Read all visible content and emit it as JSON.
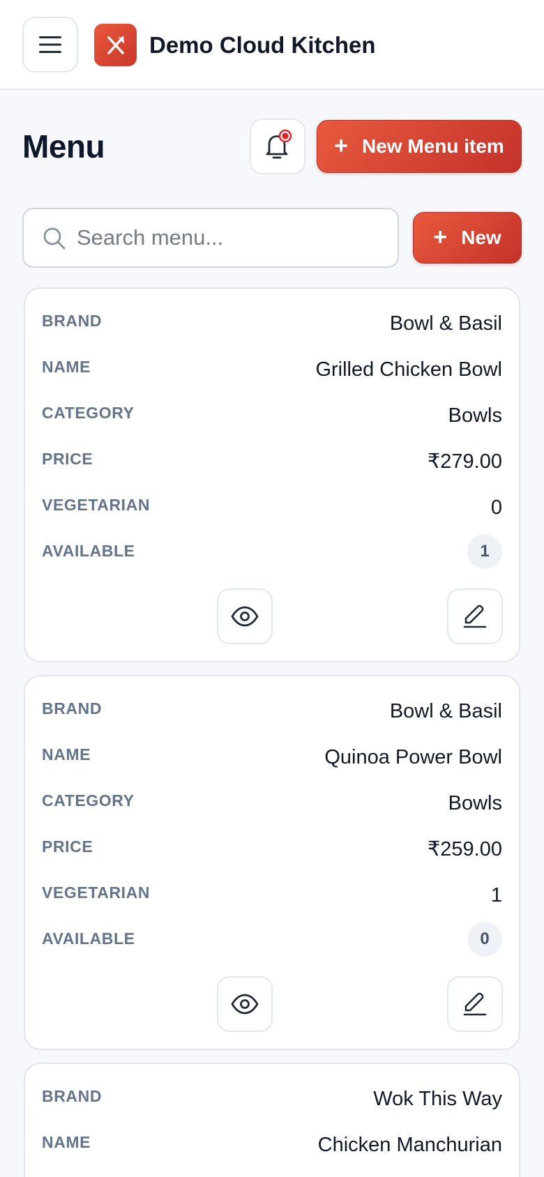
{
  "app": {
    "title": "Demo Cloud Kitchen",
    "brand_color": "#D9452F"
  },
  "header": {
    "page_title": "Menu",
    "new_menu_item_label": "New Menu item",
    "plus_glyph": "+"
  },
  "search": {
    "placeholder": "Search menu...",
    "value": "",
    "new_label": "New"
  },
  "fields": {
    "brand": "BRAND",
    "name": "NAME",
    "category": "CATEGORY",
    "price": "PRICE",
    "vegetarian": "VEGETARIAN",
    "available": "AVAILABLE"
  },
  "items": [
    {
      "brand": "Bowl & Basil",
      "name": "Grilled Chicken Bowl",
      "category": "Bowls",
      "price": "₹279.00",
      "vegetarian": "0",
      "available": "1"
    },
    {
      "brand": "Bowl & Basil",
      "name": "Quinoa Power Bowl",
      "category": "Bowls",
      "price": "₹259.00",
      "vegetarian": "1",
      "available": "0"
    },
    {
      "brand": "Wok This Way",
      "name": "Chicken Manchurian"
    }
  ],
  "icons": {
    "menu": "hamburger-icon",
    "logo": "utensils-icon",
    "notifications": "bell-icon",
    "search": "search-icon",
    "view": "eye-icon",
    "edit": "pencil-icon"
  }
}
